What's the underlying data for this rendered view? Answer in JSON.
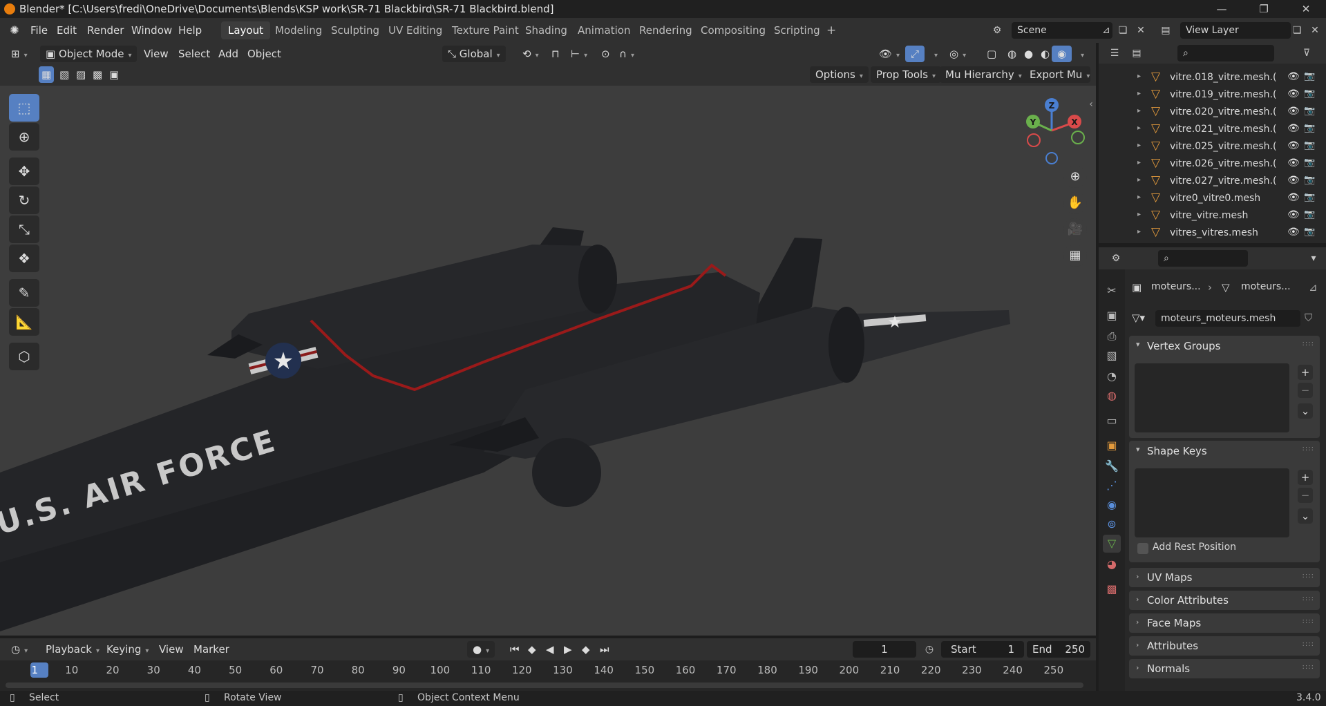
{
  "window": {
    "title": "Blender* [C:\\Users\\fredi\\OneDrive\\Documents\\Blends\\KSP work\\SR-71 Blackbird\\SR-71 Blackbird.blend]",
    "minimize": "—",
    "maximize": "❐",
    "close": "✕"
  },
  "menu": {
    "file": "File",
    "edit": "Edit",
    "render": "Render",
    "window": "Window",
    "help": "Help"
  },
  "workspaces": [
    "Layout",
    "Modeling",
    "Sculpting",
    "UV Editing",
    "Texture Paint",
    "Shading",
    "Animation",
    "Rendering",
    "Compositing",
    "Scripting"
  ],
  "workspace_add": "+",
  "scene": {
    "label": "Scene"
  },
  "view_layer": {
    "label": "View Layer"
  },
  "viewport_header": {
    "mode": "Object Mode",
    "view": "View",
    "select": "Select",
    "add": "Add",
    "object": "Object",
    "orientation": "Global"
  },
  "viewport_header2": {
    "options": "Options",
    "prop_tools": "Prop Tools",
    "mu_hierarchy": "Mu Hierarchy",
    "export_mu": "Export Mu"
  },
  "gizmo": {
    "z": "Z",
    "y": "Y",
    "x": "X"
  },
  "model_text": {
    "fuselage": "U.S. AIR FORCE"
  },
  "outliner": {
    "items": [
      "vitre.018_vitre.mesh.(",
      "vitre.019_vitre.mesh.(",
      "vitre.020_vitre.mesh.(",
      "vitre.021_vitre.mesh.(",
      "vitre.025_vitre.mesh.(",
      "vitre.026_vitre.mesh.(",
      "vitre.027_vitre.mesh.(",
      "vitre0_vitre0.mesh",
      "vitre_vitre.mesh",
      "vitres_vitres.mesh"
    ]
  },
  "properties": {
    "breadcrumb_object": "moteurs...",
    "breadcrumb_mesh": "moteurs...",
    "mesh_name": "moteurs_moteurs.mesh",
    "panels": {
      "vertex_groups": "Vertex Groups",
      "shape_keys": "Shape Keys",
      "add_rest_position": "Add Rest Position",
      "uv_maps": "UV Maps",
      "color_attributes": "Color Attributes",
      "face_maps": "Face Maps",
      "attributes": "Attributes",
      "normals": "Normals"
    }
  },
  "timeline": {
    "playback": "Playback",
    "keying": "Keying",
    "view": "View",
    "marker": "Marker",
    "current_frame": "1",
    "start_label": "Start",
    "start_value": "1",
    "end_label": "End",
    "end_value": "250",
    "ticks": [
      "1",
      "10",
      "20",
      "30",
      "40",
      "50",
      "60",
      "70",
      "80",
      "90",
      "100",
      "110",
      "120",
      "130",
      "140",
      "150",
      "160",
      "170",
      "180",
      "190",
      "200",
      "210",
      "220",
      "230",
      "240",
      "250"
    ]
  },
  "statusbar": {
    "select": "Select",
    "rotate": "Rotate View",
    "context": "Object Context Menu",
    "version": "3.4.0"
  },
  "colors": {
    "accent": "#5680c2",
    "mesh_icon": "#e39a3c",
    "viewport_bg": "#3d3d3d"
  }
}
